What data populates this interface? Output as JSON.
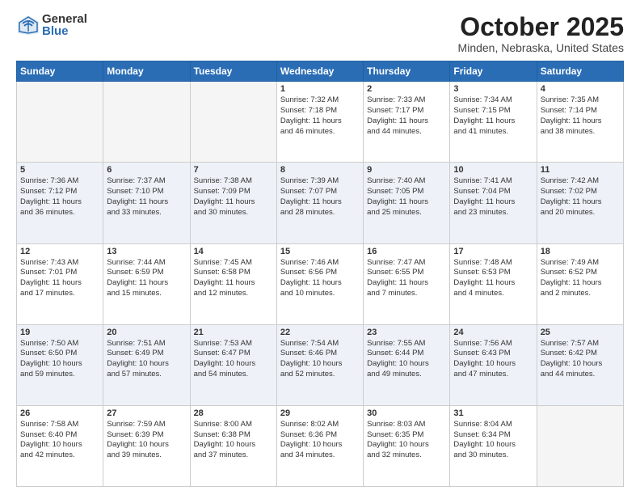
{
  "header": {
    "logo": {
      "general": "General",
      "blue": "Blue"
    },
    "month": "October 2025",
    "location": "Minden, Nebraska, United States"
  },
  "weekdays": [
    "Sunday",
    "Monday",
    "Tuesday",
    "Wednesday",
    "Thursday",
    "Friday",
    "Saturday"
  ],
  "weeks": [
    [
      {
        "day": "",
        "info": ""
      },
      {
        "day": "",
        "info": ""
      },
      {
        "day": "",
        "info": ""
      },
      {
        "day": "1",
        "info": "Sunrise: 7:32 AM\nSunset: 7:18 PM\nDaylight: 11 hours\nand 46 minutes."
      },
      {
        "day": "2",
        "info": "Sunrise: 7:33 AM\nSunset: 7:17 PM\nDaylight: 11 hours\nand 44 minutes."
      },
      {
        "day": "3",
        "info": "Sunrise: 7:34 AM\nSunset: 7:15 PM\nDaylight: 11 hours\nand 41 minutes."
      },
      {
        "day": "4",
        "info": "Sunrise: 7:35 AM\nSunset: 7:14 PM\nDaylight: 11 hours\nand 38 minutes."
      }
    ],
    [
      {
        "day": "5",
        "info": "Sunrise: 7:36 AM\nSunset: 7:12 PM\nDaylight: 11 hours\nand 36 minutes."
      },
      {
        "day": "6",
        "info": "Sunrise: 7:37 AM\nSunset: 7:10 PM\nDaylight: 11 hours\nand 33 minutes."
      },
      {
        "day": "7",
        "info": "Sunrise: 7:38 AM\nSunset: 7:09 PM\nDaylight: 11 hours\nand 30 minutes."
      },
      {
        "day": "8",
        "info": "Sunrise: 7:39 AM\nSunset: 7:07 PM\nDaylight: 11 hours\nand 28 minutes."
      },
      {
        "day": "9",
        "info": "Sunrise: 7:40 AM\nSunset: 7:05 PM\nDaylight: 11 hours\nand 25 minutes."
      },
      {
        "day": "10",
        "info": "Sunrise: 7:41 AM\nSunset: 7:04 PM\nDaylight: 11 hours\nand 23 minutes."
      },
      {
        "day": "11",
        "info": "Sunrise: 7:42 AM\nSunset: 7:02 PM\nDaylight: 11 hours\nand 20 minutes."
      }
    ],
    [
      {
        "day": "12",
        "info": "Sunrise: 7:43 AM\nSunset: 7:01 PM\nDaylight: 11 hours\nand 17 minutes."
      },
      {
        "day": "13",
        "info": "Sunrise: 7:44 AM\nSunset: 6:59 PM\nDaylight: 11 hours\nand 15 minutes."
      },
      {
        "day": "14",
        "info": "Sunrise: 7:45 AM\nSunset: 6:58 PM\nDaylight: 11 hours\nand 12 minutes."
      },
      {
        "day": "15",
        "info": "Sunrise: 7:46 AM\nSunset: 6:56 PM\nDaylight: 11 hours\nand 10 minutes."
      },
      {
        "day": "16",
        "info": "Sunrise: 7:47 AM\nSunset: 6:55 PM\nDaylight: 11 hours\nand 7 minutes."
      },
      {
        "day": "17",
        "info": "Sunrise: 7:48 AM\nSunset: 6:53 PM\nDaylight: 11 hours\nand 4 minutes."
      },
      {
        "day": "18",
        "info": "Sunrise: 7:49 AM\nSunset: 6:52 PM\nDaylight: 11 hours\nand 2 minutes."
      }
    ],
    [
      {
        "day": "19",
        "info": "Sunrise: 7:50 AM\nSunset: 6:50 PM\nDaylight: 10 hours\nand 59 minutes."
      },
      {
        "day": "20",
        "info": "Sunrise: 7:51 AM\nSunset: 6:49 PM\nDaylight: 10 hours\nand 57 minutes."
      },
      {
        "day": "21",
        "info": "Sunrise: 7:53 AM\nSunset: 6:47 PM\nDaylight: 10 hours\nand 54 minutes."
      },
      {
        "day": "22",
        "info": "Sunrise: 7:54 AM\nSunset: 6:46 PM\nDaylight: 10 hours\nand 52 minutes."
      },
      {
        "day": "23",
        "info": "Sunrise: 7:55 AM\nSunset: 6:44 PM\nDaylight: 10 hours\nand 49 minutes."
      },
      {
        "day": "24",
        "info": "Sunrise: 7:56 AM\nSunset: 6:43 PM\nDaylight: 10 hours\nand 47 minutes."
      },
      {
        "day": "25",
        "info": "Sunrise: 7:57 AM\nSunset: 6:42 PM\nDaylight: 10 hours\nand 44 minutes."
      }
    ],
    [
      {
        "day": "26",
        "info": "Sunrise: 7:58 AM\nSunset: 6:40 PM\nDaylight: 10 hours\nand 42 minutes."
      },
      {
        "day": "27",
        "info": "Sunrise: 7:59 AM\nSunset: 6:39 PM\nDaylight: 10 hours\nand 39 minutes."
      },
      {
        "day": "28",
        "info": "Sunrise: 8:00 AM\nSunset: 6:38 PM\nDaylight: 10 hours\nand 37 minutes."
      },
      {
        "day": "29",
        "info": "Sunrise: 8:02 AM\nSunset: 6:36 PM\nDaylight: 10 hours\nand 34 minutes."
      },
      {
        "day": "30",
        "info": "Sunrise: 8:03 AM\nSunset: 6:35 PM\nDaylight: 10 hours\nand 32 minutes."
      },
      {
        "day": "31",
        "info": "Sunrise: 8:04 AM\nSunset: 6:34 PM\nDaylight: 10 hours\nand 30 minutes."
      },
      {
        "day": "",
        "info": ""
      }
    ]
  ]
}
